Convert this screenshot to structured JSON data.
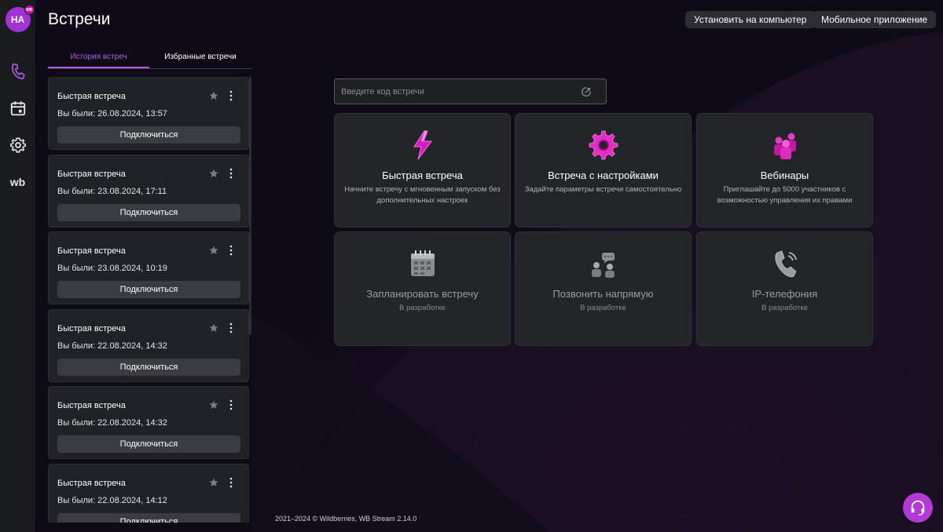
{
  "header": {
    "title": "Встречи",
    "install_label": "Установить на компьютер",
    "mobile_label": "Мобильное приложение"
  },
  "user": {
    "initials": "НА",
    "badge": "WB"
  },
  "rail": {
    "wb_label": "wb"
  },
  "tabs": {
    "history": "История встреч",
    "favorites": "Избранные встречи"
  },
  "history": [
    {
      "title": "Быстрая встреча",
      "date": "Вы были: 26.08.2024, 13:57",
      "button": "Подключиться"
    },
    {
      "title": "Быстрая встреча",
      "date": "Вы были: 23.08.2024, 17:11",
      "button": "Подключиться"
    },
    {
      "title": "Быстрая встреча",
      "date": "Вы были: 23.08.2024, 10:19",
      "button": "Подключиться"
    },
    {
      "title": "Быстрая встреча",
      "date": "Вы были: 22.08.2024, 14:32",
      "button": "Подключиться"
    },
    {
      "title": "Быстрая встреча",
      "date": "Вы были: 22.08.2024, 14:32",
      "button": "Подключиться"
    },
    {
      "title": "Быстрая встреча",
      "date": "Вы были: 22.08.2024, 14:12",
      "button": "Подключиться"
    }
  ],
  "search": {
    "placeholder": "Введите код встречи"
  },
  "tiles": [
    {
      "icon": "lightning-icon",
      "title": "Быстрая встреча",
      "desc": "Начните встречу с мгновенным запуском без дополнительных настроек"
    },
    {
      "icon": "gear-icon",
      "title": "Встреча с настройками",
      "desc": "Задайте параметры встречи самостоятельно"
    },
    {
      "icon": "group-icon",
      "title": "Вебинары",
      "desc": "Приглашайте до 5000 участников с возможностью управления их правами"
    },
    {
      "icon": "calendar-icon",
      "title": "Запланировать встречу",
      "desc": "В разработке"
    },
    {
      "icon": "chat-users-icon",
      "title": "Позвонить напрямую",
      "desc": "В разработке"
    },
    {
      "icon": "phone-icon",
      "title": "IP-телефония",
      "desc": "В разработке"
    }
  ],
  "footer": {
    "text": "2021–2024 © Wildberries, WB Stream 2.14.0"
  },
  "colors": {
    "accent": "#b65ae6",
    "avatar": "#a033d6",
    "support": "#b33ad6"
  }
}
